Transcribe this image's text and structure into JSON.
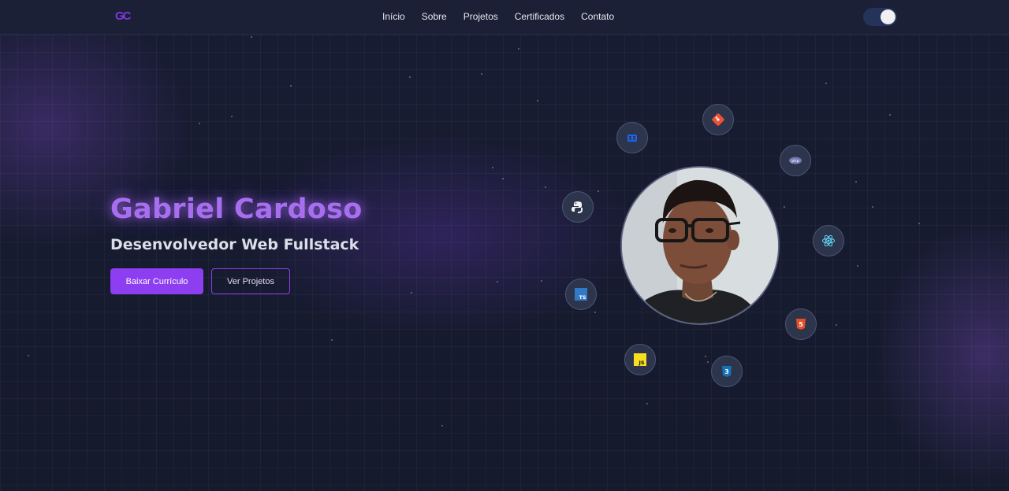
{
  "brand": {
    "logo": "GC"
  },
  "nav": {
    "items": [
      "Início",
      "Sobre",
      "Projetos",
      "Certificados",
      "Contato"
    ]
  },
  "theme_toggle": {
    "icon": "moon-icon",
    "state": "dark"
  },
  "hero": {
    "name": "Gabriel Cardoso",
    "role": "Desenvolvedor Web Fullstack",
    "primary_button": "Baixar Currículo",
    "secondary_button": "Ver Projetos"
  },
  "profile": {
    "image": "profile-photo"
  },
  "tech_icons": [
    "git-icon",
    "php-icon",
    "react-icon",
    "html5-icon",
    "css3-icon",
    "javascript-icon",
    "typescript-icon",
    "python-icon",
    "docker-icon"
  ],
  "colors": {
    "accent": "#8d3ef0",
    "name_glow": "#a86ef0",
    "background": "#161a2e",
    "navbar": "#1b2036"
  }
}
